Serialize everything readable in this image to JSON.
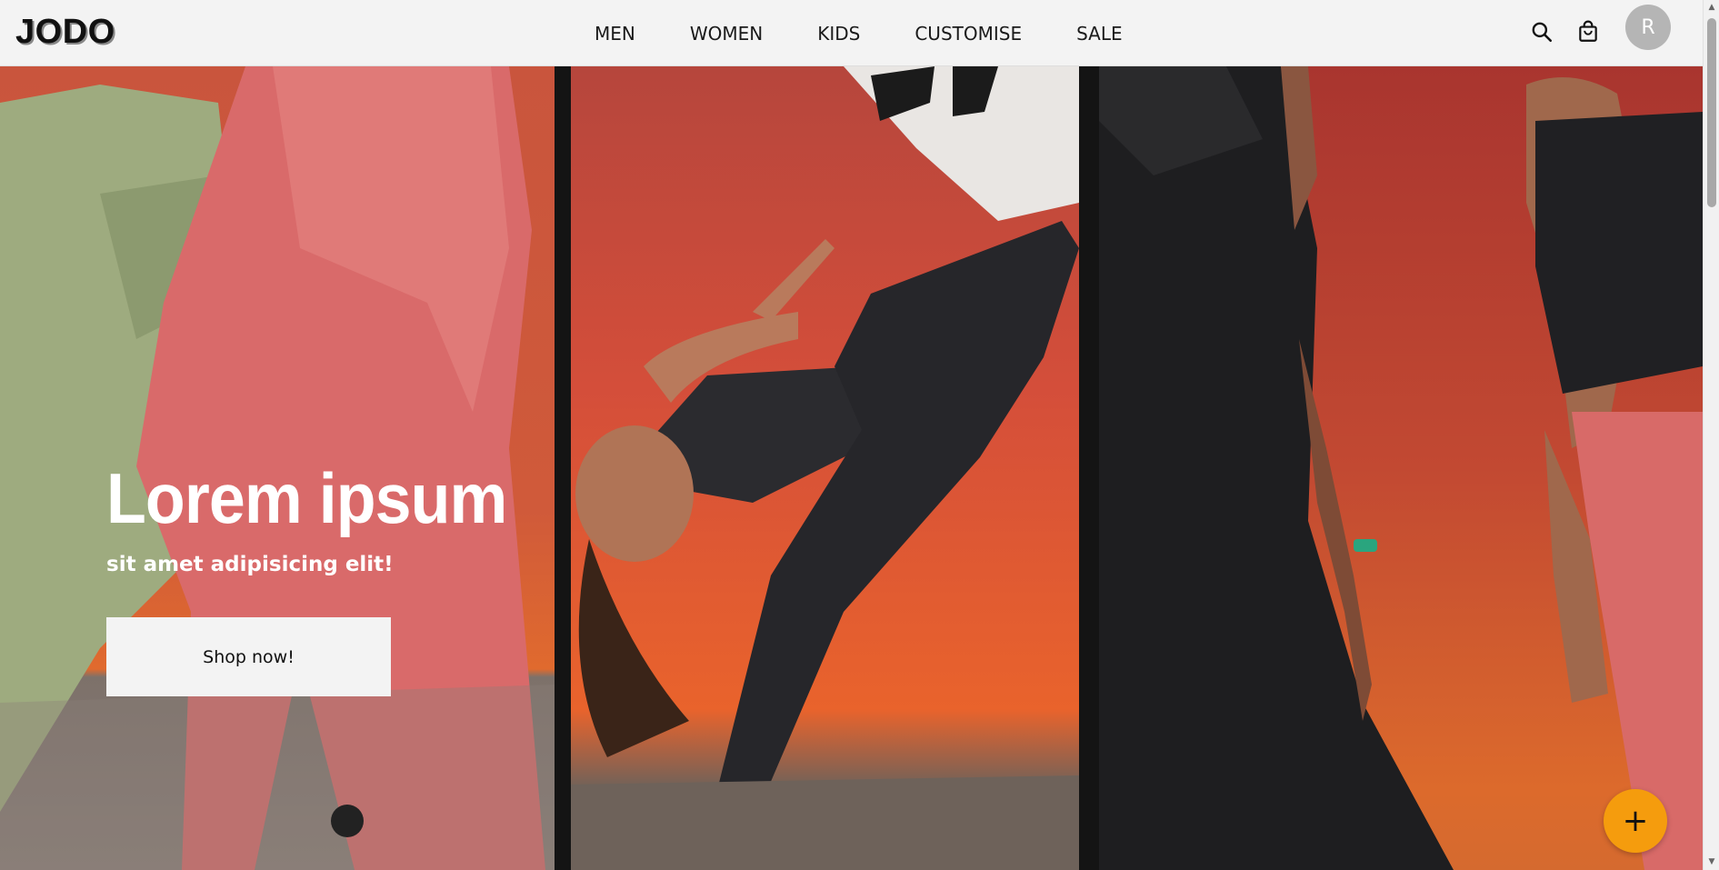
{
  "brand": {
    "logo_text": "JODO"
  },
  "nav": {
    "items": [
      {
        "label": "MEN"
      },
      {
        "label": "WOMEN"
      },
      {
        "label": "KIDS"
      },
      {
        "label": "CUSTOMISE"
      },
      {
        "label": "SALE"
      }
    ]
  },
  "header_icons": {
    "search": "search-icon",
    "cart": "shopping-bag-icon"
  },
  "user": {
    "avatar_initial": "R"
  },
  "hero": {
    "title": "Lorem ipsum",
    "subtitle": "sit amet adipisicing elit!",
    "cta_label": "Shop now!"
  },
  "fab": {
    "icon": "plus-icon",
    "symbol": "+"
  },
  "colors": {
    "header_bg": "#f3f3f3",
    "accent_fab": "#f59c0d",
    "avatar_bg": "#b5b5b5",
    "hero_orange": "#e0652e"
  }
}
